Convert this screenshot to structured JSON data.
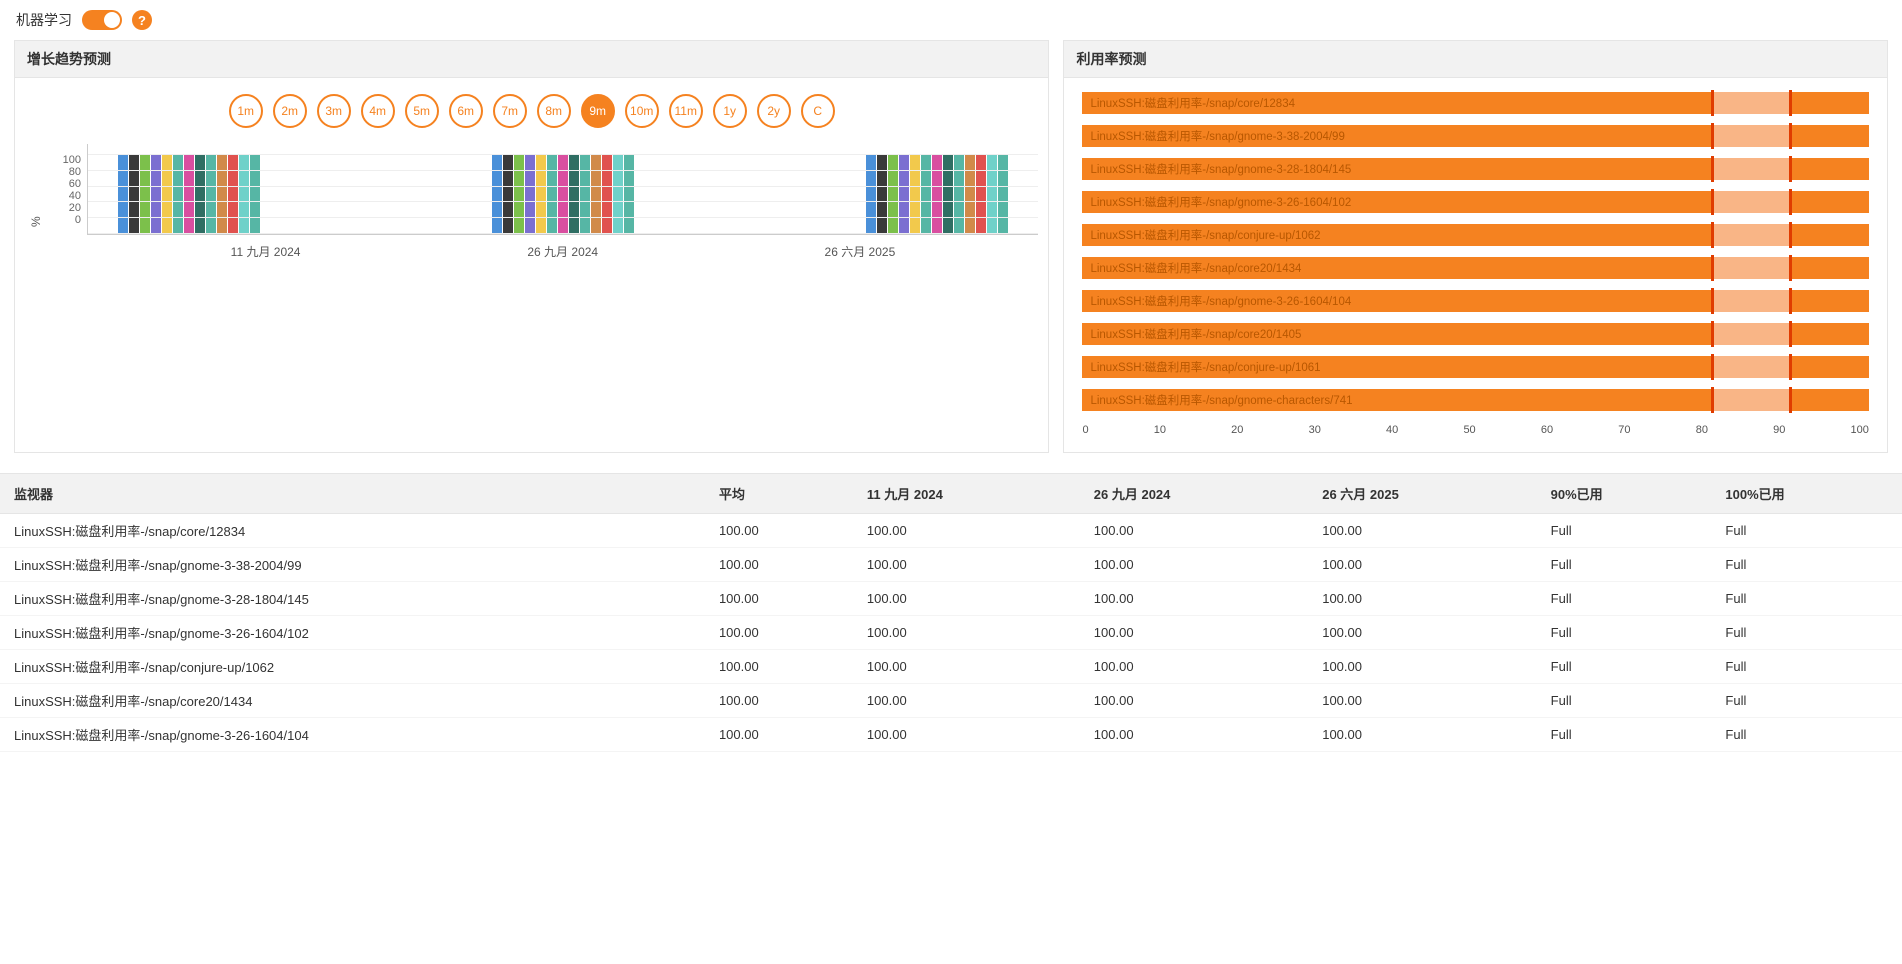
{
  "topbar": {
    "ml_label": "机器学习"
  },
  "panels": {
    "growth": {
      "title": "增长趋势预测"
    },
    "util": {
      "title": "利用率预测"
    }
  },
  "time_pills": [
    "1m",
    "2m",
    "3m",
    "4m",
    "5m",
    "6m",
    "7m",
    "8m",
    "9m",
    "10m",
    "11m",
    "1y",
    "2y",
    "C"
  ],
  "time_active_index": 8,
  "chart_data": {
    "type": "bar",
    "title": "增长趋势预测",
    "ylabel": "%",
    "ylim": [
      0,
      100
    ],
    "yticks": [
      0,
      20,
      40,
      60,
      80,
      100
    ],
    "colors": [
      "#4a90d9",
      "#3a3a3a",
      "#7cc04b",
      "#7b6fd1",
      "#f2c94c",
      "#56b6a5",
      "#d94fa0",
      "#2f6e63",
      "#56b6a5",
      "#d18a4a",
      "#e0524f",
      "#6fd1c9",
      "#56b6a5"
    ],
    "categories": [
      "11 九月 2024",
      "26 九月 2024",
      "26 六月 2025"
    ],
    "bars_per_group": 13,
    "data_value": 100
  },
  "util_chart": {
    "type": "horizontal-bar",
    "title": "利用率预测",
    "xlim": [
      0,
      100
    ],
    "xticks": [
      0,
      10,
      20,
      30,
      40,
      50,
      60,
      70,
      80,
      90,
      100
    ],
    "marker_positions": [
      80,
      90
    ],
    "items": [
      {
        "label": "LinuxSSH:磁盘利用率-/snap/core/12834",
        "seg_a": 80,
        "seg_b": 10,
        "seg_c": 10
      },
      {
        "label": "LinuxSSH:磁盘利用率-/snap/gnome-3-38-2004/99",
        "seg_a": 80,
        "seg_b": 10,
        "seg_c": 10
      },
      {
        "label": "LinuxSSH:磁盘利用率-/snap/gnome-3-28-1804/145",
        "seg_a": 80,
        "seg_b": 10,
        "seg_c": 10
      },
      {
        "label": "LinuxSSH:磁盘利用率-/snap/gnome-3-26-1604/102",
        "seg_a": 80,
        "seg_b": 10,
        "seg_c": 10
      },
      {
        "label": "LinuxSSH:磁盘利用率-/snap/conjure-up/1062",
        "seg_a": 80,
        "seg_b": 10,
        "seg_c": 10
      },
      {
        "label": "LinuxSSH:磁盘利用率-/snap/core20/1434",
        "seg_a": 80,
        "seg_b": 10,
        "seg_c": 10
      },
      {
        "label": "LinuxSSH:磁盘利用率-/snap/gnome-3-26-1604/104",
        "seg_a": 80,
        "seg_b": 10,
        "seg_c": 10
      },
      {
        "label": "LinuxSSH:磁盘利用率-/snap/core20/1405",
        "seg_a": 80,
        "seg_b": 10,
        "seg_c": 10
      },
      {
        "label": "LinuxSSH:磁盘利用率-/snap/conjure-up/1061",
        "seg_a": 80,
        "seg_b": 10,
        "seg_c": 10
      },
      {
        "label": "LinuxSSH:磁盘利用率-/snap/gnome-characters/741",
        "seg_a": 80,
        "seg_b": 10,
        "seg_c": 10
      }
    ]
  },
  "table": {
    "columns": [
      "监视器",
      "平均",
      "11 九月 2024",
      "26 九月 2024",
      "26 六月 2025",
      "90%已用",
      "100%已用"
    ],
    "rows": [
      {
        "name": "LinuxSSH:磁盘利用率-/snap/core/12834",
        "avg": "100.00",
        "c1": "100.00",
        "c2": "100.00",
        "c3": "100.00",
        "p90": "Full",
        "p100": "Full"
      },
      {
        "name": "LinuxSSH:磁盘利用率-/snap/gnome-3-38-2004/99",
        "avg": "100.00",
        "c1": "100.00",
        "c2": "100.00",
        "c3": "100.00",
        "p90": "Full",
        "p100": "Full"
      },
      {
        "name": "LinuxSSH:磁盘利用率-/snap/gnome-3-28-1804/145",
        "avg": "100.00",
        "c1": "100.00",
        "c2": "100.00",
        "c3": "100.00",
        "p90": "Full",
        "p100": "Full"
      },
      {
        "name": "LinuxSSH:磁盘利用率-/snap/gnome-3-26-1604/102",
        "avg": "100.00",
        "c1": "100.00",
        "c2": "100.00",
        "c3": "100.00",
        "p90": "Full",
        "p100": "Full"
      },
      {
        "name": "LinuxSSH:磁盘利用率-/snap/conjure-up/1062",
        "avg": "100.00",
        "c1": "100.00",
        "c2": "100.00",
        "c3": "100.00",
        "p90": "Full",
        "p100": "Full"
      },
      {
        "name": "LinuxSSH:磁盘利用率-/snap/core20/1434",
        "avg": "100.00",
        "c1": "100.00",
        "c2": "100.00",
        "c3": "100.00",
        "p90": "Full",
        "p100": "Full"
      },
      {
        "name": "LinuxSSH:磁盘利用率-/snap/gnome-3-26-1604/104",
        "avg": "100.00",
        "c1": "100.00",
        "c2": "100.00",
        "c3": "100.00",
        "p90": "Full",
        "p100": "Full"
      }
    ]
  }
}
